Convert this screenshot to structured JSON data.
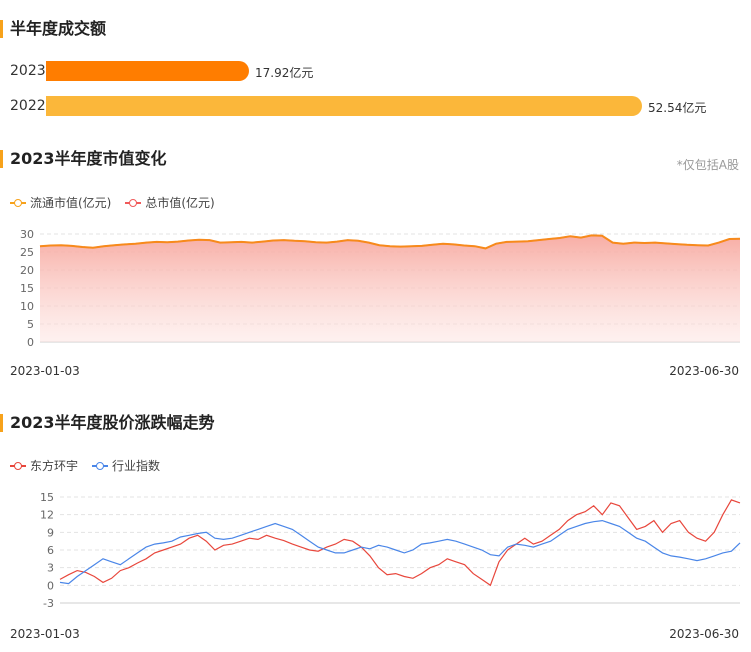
{
  "section1": {
    "title": "半年度成交额",
    "bars": [
      {
        "year": "2023",
        "value": 17.92,
        "label": "17.92亿元",
        "color": "#ff7d00"
      },
      {
        "year": "2022",
        "value": 52.54,
        "label": "52.54亿元",
        "color": "#fbb73a"
      }
    ]
  },
  "section2": {
    "title": "2023半年度市值变化",
    "note": "*仅包括A股",
    "legend": [
      {
        "label": "流通市值(亿元)",
        "color": "#f7a21b"
      },
      {
        "label": "总市值(亿元)",
        "color": "#f05a5a"
      }
    ],
    "start_date": "2023-01-03",
    "end_date": "2023-06-30"
  },
  "section3": {
    "title": "2023半年度股价涨跌幅走势",
    "legend": [
      {
        "label": "东方环宇",
        "color": "#e8473c"
      },
      {
        "label": "行业指数",
        "color": "#4a86e8"
      }
    ],
    "start_date": "2023-01-03",
    "end_date": "2023-06-30"
  },
  "chart_data": [
    {
      "type": "bar",
      "categories": [
        "2023",
        "2022"
      ],
      "values": [
        17.92,
        52.54
      ],
      "title": "半年度成交额"
    },
    {
      "type": "area",
      "title": "2023半年度市值变化",
      "ylim": [
        0,
        30
      ],
      "yticks": [
        0,
        5,
        10,
        15,
        20,
        25,
        30
      ],
      "x_labels": [
        "2023-01-03",
        "2023-06-30"
      ],
      "series": [
        {
          "name": "流通市值(亿元)",
          "values": [
            26.6,
            26.8,
            26.9,
            26.7,
            26.4,
            26.2,
            26.6,
            26.9,
            27.1,
            27.3,
            27.6,
            27.8,
            27.7,
            27.9,
            28.2,
            28.4,
            28.3,
            27.6,
            27.7,
            27.8,
            27.6,
            27.9,
            28.2,
            28.3,
            28.1,
            28.0,
            27.7,
            27.6,
            27.9,
            28.3,
            28.1,
            27.6,
            26.9,
            26.6,
            26.5,
            26.6,
            26.7,
            27.0,
            27.3,
            27.1,
            26.8,
            26.6,
            26.0,
            27.3,
            27.8,
            27.9,
            28.0,
            28.3,
            28.6,
            28.9,
            29.4,
            29.0,
            29.6,
            29.5,
            27.6,
            27.3,
            27.6,
            27.5,
            27.6,
            27.4,
            27.2,
            27.0,
            26.9,
            26.8,
            27.6,
            28.6,
            28.7
          ]
        },
        {
          "name": "总市值(亿元)",
          "values": [
            26.6,
            26.8,
            26.9,
            26.7,
            26.4,
            26.2,
            26.6,
            26.9,
            27.1,
            27.3,
            27.6,
            27.8,
            27.7,
            27.9,
            28.2,
            28.4,
            28.3,
            27.6,
            27.7,
            27.8,
            27.6,
            27.9,
            28.2,
            28.3,
            28.1,
            28.0,
            27.7,
            27.6,
            27.9,
            28.3,
            28.1,
            27.6,
            26.9,
            26.6,
            26.5,
            26.6,
            26.7,
            27.0,
            27.3,
            27.1,
            26.8,
            26.6,
            26.0,
            27.3,
            27.8,
            27.9,
            28.0,
            28.3,
            28.6,
            28.9,
            29.4,
            29.0,
            29.6,
            29.5,
            27.6,
            27.3,
            27.6,
            27.5,
            27.6,
            27.4,
            27.2,
            27.0,
            26.9,
            26.8,
            27.6,
            28.6,
            28.7
          ]
        }
      ]
    },
    {
      "type": "line",
      "title": "2023半年度股价涨跌幅走势",
      "ylim": [
        -3,
        15
      ],
      "yticks": [
        -3,
        0,
        3,
        6,
        9,
        12,
        15
      ],
      "x_labels": [
        "2023-01-03",
        "2023-06-30"
      ],
      "series": [
        {
          "name": "东方环宇",
          "values": [
            1.0,
            1.8,
            2.5,
            2.2,
            1.5,
            0.5,
            1.2,
            2.5,
            3.0,
            3.8,
            4.5,
            5.5,
            6.0,
            6.5,
            7.0,
            8.0,
            8.5,
            7.5,
            6.0,
            6.8,
            7.0,
            7.5,
            8.0,
            7.8,
            8.5,
            8.0,
            7.6,
            7.0,
            6.5,
            6.0,
            5.8,
            6.5,
            7.0,
            7.8,
            7.5,
            6.5,
            5.0,
            3.0,
            1.8,
            2.0,
            1.5,
            1.2,
            2.0,
            3.0,
            3.5,
            4.5,
            4.0,
            3.5,
            2.0,
            1.0,
            0.0,
            4.0,
            6.0,
            7.0,
            8.0,
            7.0,
            7.5,
            8.5,
            9.5,
            11.0,
            12.0,
            12.5,
            13.5,
            12.0,
            14.0,
            13.5,
            11.5,
            9.5,
            10.0,
            11.0,
            9.0,
            10.5,
            11.0,
            9.0,
            8.0,
            7.5,
            9.0,
            12.0,
            14.5,
            14.0
          ]
        },
        {
          "name": "行业指数",
          "values": [
            0.5,
            0.3,
            1.5,
            2.5,
            3.5,
            4.5,
            4.0,
            3.5,
            4.5,
            5.5,
            6.5,
            7.0,
            7.2,
            7.5,
            8.2,
            8.5,
            8.8,
            9.0,
            8.0,
            7.8,
            8.0,
            8.5,
            9.0,
            9.5,
            10.0,
            10.5,
            10.0,
            9.5,
            8.5,
            7.5,
            6.5,
            6.0,
            5.5,
            5.5,
            6.0,
            6.5,
            6.2,
            6.8,
            6.5,
            6.0,
            5.5,
            6.0,
            7.0,
            7.2,
            7.5,
            7.8,
            7.5,
            7.0,
            6.5,
            6.0,
            5.2,
            5.0,
            6.5,
            7.0,
            6.8,
            6.5,
            7.0,
            7.5,
            8.5,
            9.5,
            10.0,
            10.5,
            10.8,
            11.0,
            10.5,
            10.0,
            9.0,
            8.0,
            7.5,
            6.5,
            5.5,
            5.0,
            4.8,
            4.5,
            4.2,
            4.5,
            5.0,
            5.5,
            5.8,
            7.2
          ]
        }
      ]
    }
  ]
}
